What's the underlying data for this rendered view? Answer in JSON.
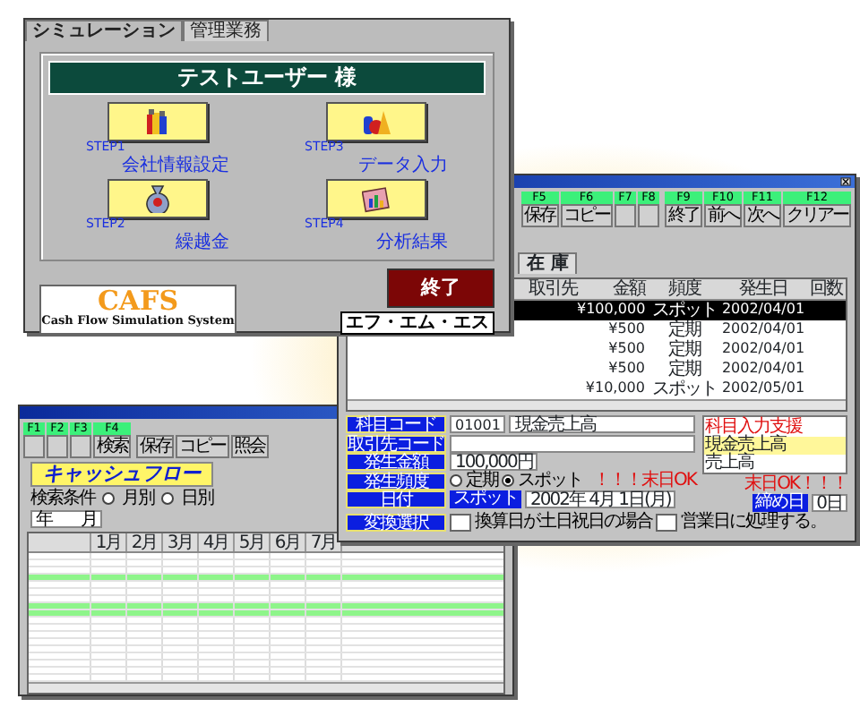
{
  "main_window": {
    "tabs": [
      {
        "label": "シミュレーション",
        "selected": true
      },
      {
        "label": "管理業務",
        "selected": false
      }
    ],
    "user_banner": "テストユーザー 様",
    "steps": [
      {
        "step": "STEP1",
        "label": "会社情報設定",
        "kind": "bottles"
      },
      {
        "step": "STEP3",
        "label": "データ入力",
        "kind": "tools"
      },
      {
        "step": "STEP2",
        "label": "繰越金",
        "kind": "money-bag"
      },
      {
        "step": "STEP4",
        "label": "分析結果",
        "kind": "chart"
      }
    ],
    "logo": {
      "title": "CAFS",
      "subtitle": "Cash Flow Simulation System"
    },
    "exit_button": "終了",
    "company": "エフ・エム・エス"
  },
  "entry_window": {
    "function_key_groups": [
      [
        {
          "key": "F5",
          "label": "保存"
        },
        {
          "key": "F6",
          "label": "コピー"
        },
        {
          "key": "F7"
        },
        {
          "key": "F8"
        }
      ],
      [
        {
          "key": "F9",
          "label": "終了"
        },
        {
          "key": "F10",
          "label": "前へ"
        },
        {
          "key": "F11",
          "label": "次へ"
        },
        {
          "key": "F12",
          "label": "クリアー"
        }
      ]
    ],
    "tab": "在 庫",
    "table": {
      "columns": [
        "取引先",
        "金額",
        "頻度",
        "発生日",
        "回数"
      ],
      "rows": [
        {
          "selected": true,
          "amount": "¥100,000",
          "frequency": "スポット",
          "date": "2002/04/01"
        },
        {
          "selected": false,
          "amount": "¥500",
          "frequency": "定期",
          "date": "2002/04/01"
        },
        {
          "selected": false,
          "amount": "¥500",
          "frequency": "定期",
          "date": "2002/04/01"
        },
        {
          "selected": false,
          "amount": "¥500",
          "frequency": "定期",
          "date": "2002/04/01"
        },
        {
          "selected": false,
          "amount": "¥10,000",
          "frequency": "スポット",
          "date": "2002/05/01"
        }
      ]
    },
    "form": {
      "subject_code": {
        "label": "科目コード",
        "code": "01001",
        "name": "現金売上高"
      },
      "partner_code": {
        "label": "取引先コード"
      },
      "amount": {
        "label": "発生金額",
        "value": "100,000円"
      },
      "frequency": {
        "label": "発生頻度",
        "options": [
          {
            "label": "定期",
            "selected": false
          },
          {
            "label": "スポット",
            "selected": true
          }
        ],
        "note": "！！！末日OK"
      },
      "date": {
        "label": "日付",
        "sub_label": "スポット",
        "value": "2002年 4月 1日(月)"
      },
      "conversion": {
        "label": "変換選択",
        "text_before": "換算日が土日祝日の場合",
        "text_after": "営業日に処理する。"
      }
    },
    "input_support": {
      "title": "科目入力支援",
      "items": [
        {
          "label": "現金売上高",
          "selected": true
        },
        {
          "label": "売上高",
          "selected": false
        }
      ]
    },
    "month_end_note": "末日OK！！！",
    "closing_day": {
      "label": "締め日",
      "value": "0日"
    }
  },
  "cashflow_window": {
    "function_key_groups": [
      [
        {
          "key": "F1"
        },
        {
          "key": "F2"
        },
        {
          "key": "F3"
        },
        {
          "key": "F4",
          "label": "検索"
        }
      ],
      [
        {
          "label": "保存"
        },
        {
          "label": "コピー"
        },
        {
          "label": "照会"
        }
      ]
    ],
    "title": "キャッシュフロー",
    "search_label": "検索条件",
    "period_options": [
      {
        "label": "月別",
        "selected": false
      },
      {
        "label": "日別",
        "selected": false
      }
    ],
    "year_month": [
      "年",
      "月"
    ],
    "grid": {
      "columns": [
        "1月",
        "2月",
        "3月",
        "4月",
        "5月",
        "6月",
        "7月"
      ],
      "rows": [
        {
          "highlighted": false
        },
        {
          "highlighted": false
        },
        {
          "highlighted": false
        },
        {
          "highlighted": true
        },
        {
          "highlighted": false
        },
        {
          "highlighted": false
        },
        {
          "highlighted": false
        },
        {
          "highlighted": true
        },
        {
          "highlighted": true
        },
        {
          "highlighted": false
        },
        {
          "highlighted": false
        },
        {
          "highlighted": false
        },
        {
          "highlighted": false
        },
        {
          "highlighted": false
        },
        {
          "highlighted": false
        },
        {
          "highlighted": false
        },
        {
          "highlighted": false
        },
        {
          "highlighted": false
        }
      ]
    }
  }
}
